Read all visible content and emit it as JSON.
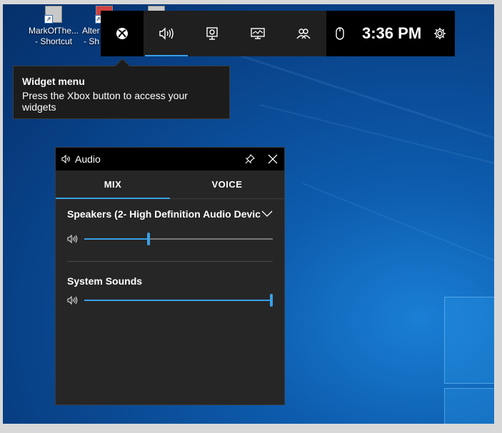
{
  "desktop": {
    "icons": [
      {
        "label_line1": "MarkOfThe...",
        "label_line2": "- Shortcut"
      },
      {
        "label_line1": "Alter",
        "label_line2": "- Sh"
      }
    ]
  },
  "gamebar": {
    "buttons": [
      {
        "icon": "xbox-icon"
      },
      {
        "icon": "audio-icon",
        "active": true
      },
      {
        "icon": "capture-icon"
      },
      {
        "icon": "performance-icon"
      },
      {
        "icon": "social-icon"
      }
    ],
    "mouse_icon": "mouse-icon",
    "clock": "3:36 PM",
    "settings_icon": "gear-icon",
    "accent": "#3aa0e6"
  },
  "tooltip": {
    "title": "Widget menu",
    "body": "Press the Xbox button to access your widgets"
  },
  "audio": {
    "title": "Audio",
    "tabs": [
      {
        "label": "MIX",
        "active": true
      },
      {
        "label": "VOICE",
        "active": false
      }
    ],
    "device": "Speakers (2- High Definition Audio Devic...",
    "device_volume": 34,
    "apps": [
      {
        "name": "System Sounds",
        "volume": 100
      }
    ]
  }
}
